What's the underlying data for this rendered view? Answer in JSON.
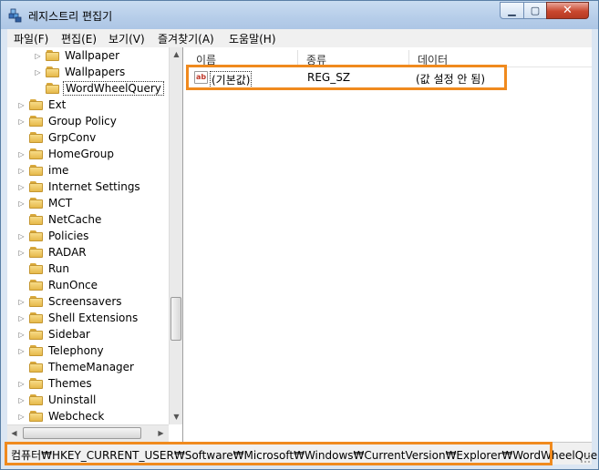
{
  "window": {
    "title": "레지스트리 편집기"
  },
  "menu": [
    "파일(F)",
    "편집(E)",
    "보기(V)",
    "즐겨찾기(A)",
    "도움말(H)"
  ],
  "tree": {
    "items": [
      {
        "label": "Wallpaper",
        "level": 2,
        "expander": "▷"
      },
      {
        "label": "Wallpapers",
        "level": 2,
        "expander": "▷"
      },
      {
        "label": "WordWheelQuery",
        "level": 2,
        "expander": "",
        "selected": true
      },
      {
        "label": "Ext",
        "level": 1,
        "expander": "▷"
      },
      {
        "label": "Group Policy",
        "level": 1,
        "expander": "▷"
      },
      {
        "label": "GrpConv",
        "level": 1,
        "expander": ""
      },
      {
        "label": "HomeGroup",
        "level": 1,
        "expander": "▷"
      },
      {
        "label": "ime",
        "level": 1,
        "expander": "▷"
      },
      {
        "label": "Internet Settings",
        "level": 1,
        "expander": "▷"
      },
      {
        "label": "MCT",
        "level": 1,
        "expander": "▷"
      },
      {
        "label": "NetCache",
        "level": 1,
        "expander": ""
      },
      {
        "label": "Policies",
        "level": 1,
        "expander": "▷"
      },
      {
        "label": "RADAR",
        "level": 1,
        "expander": "▷"
      },
      {
        "label": "Run",
        "level": 1,
        "expander": ""
      },
      {
        "label": "RunOnce",
        "level": 1,
        "expander": ""
      },
      {
        "label": "Screensavers",
        "level": 1,
        "expander": "▷"
      },
      {
        "label": "Shell Extensions",
        "level": 1,
        "expander": "▷"
      },
      {
        "label": "Sidebar",
        "level": 1,
        "expander": "▷"
      },
      {
        "label": "Telephony",
        "level": 1,
        "expander": "▷"
      },
      {
        "label": "ThemeManager",
        "level": 1,
        "expander": ""
      },
      {
        "label": "Themes",
        "level": 1,
        "expander": "▷"
      },
      {
        "label": "Uninstall",
        "level": 1,
        "expander": "▷"
      },
      {
        "label": "Webcheck",
        "level": 1,
        "expander": "▷"
      }
    ]
  },
  "list": {
    "columns": [
      "이름",
      "종류",
      "데이터"
    ],
    "rows": [
      {
        "icon": "ab",
        "name": "(기본값)",
        "type": "REG_SZ",
        "data": "(값 설정 안 됨)"
      }
    ]
  },
  "status": {
    "path": "컴퓨터₩HKEY_CURRENT_USER₩Software₩Microsoft₩Windows₩CurrentVersion₩Explorer₩WordWheelQuery"
  },
  "colors": {
    "highlight": "#f08a1e",
    "folder": "#e6b94a"
  },
  "icons": {
    "app": "registry-editor-icon",
    "folder": "folder-icon",
    "value": "string-value-icon"
  }
}
